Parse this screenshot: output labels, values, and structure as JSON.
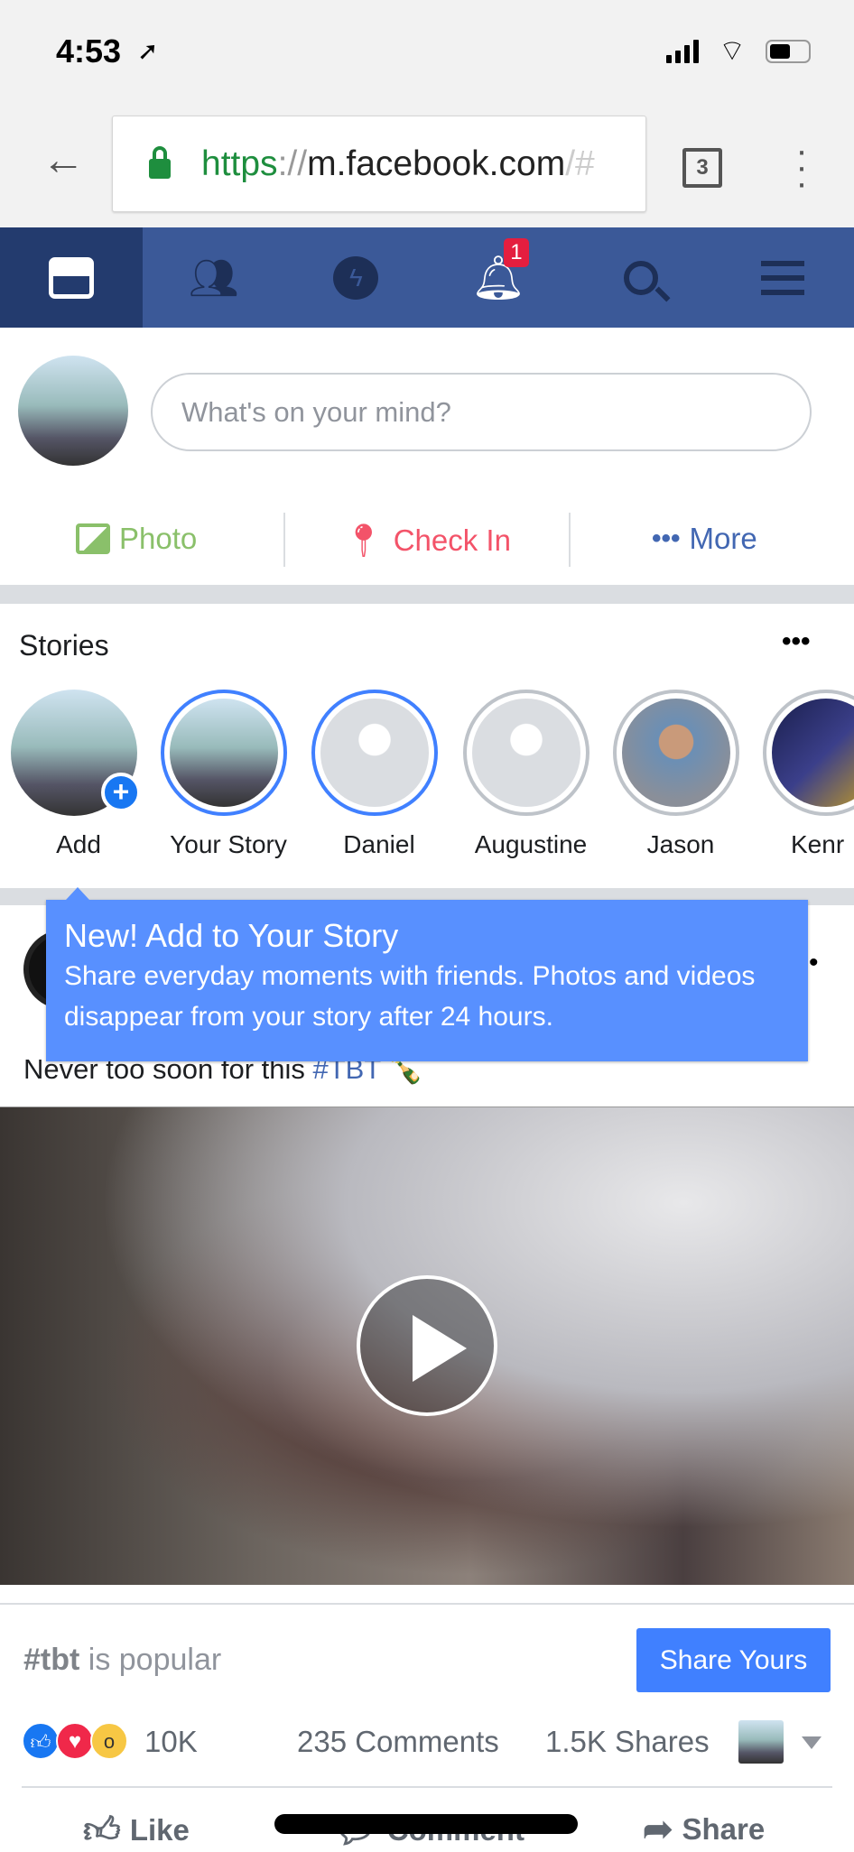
{
  "status": {
    "time": "4:53"
  },
  "browser": {
    "url_scheme": "https",
    "url_sep": "://",
    "url_host": "m.facebook.com",
    "url_rest": "/#",
    "tab_count": "3"
  },
  "nav": {
    "notification_count": "1",
    "accent": "#3b5998"
  },
  "composer": {
    "placeholder": "What's on your mind?",
    "photo": "Photo",
    "checkin": "Check In",
    "more": "More"
  },
  "stories": {
    "title": "Stories",
    "items": [
      {
        "name": "Add"
      },
      {
        "name": "Your Story"
      },
      {
        "name": "Daniel"
      },
      {
        "name": "Augustine"
      },
      {
        "name": "Jason"
      },
      {
        "name": "Kenr"
      }
    ]
  },
  "tooltip": {
    "title": "New! Add to Your Story",
    "body": "Share everyday moments with friends. Photos and videos disappear from your story after 24 hours."
  },
  "post": {
    "text": "Never too soon for this ",
    "hashtag": "#TBT",
    "popular_tag": "#tbt",
    "popular_text": " is popular",
    "share_yours": "Share Yours",
    "reactions": "10K",
    "comments": "235 Comments",
    "shares": "1.5K Shares",
    "like": "Like",
    "comment": "Comment",
    "share": "Share"
  }
}
